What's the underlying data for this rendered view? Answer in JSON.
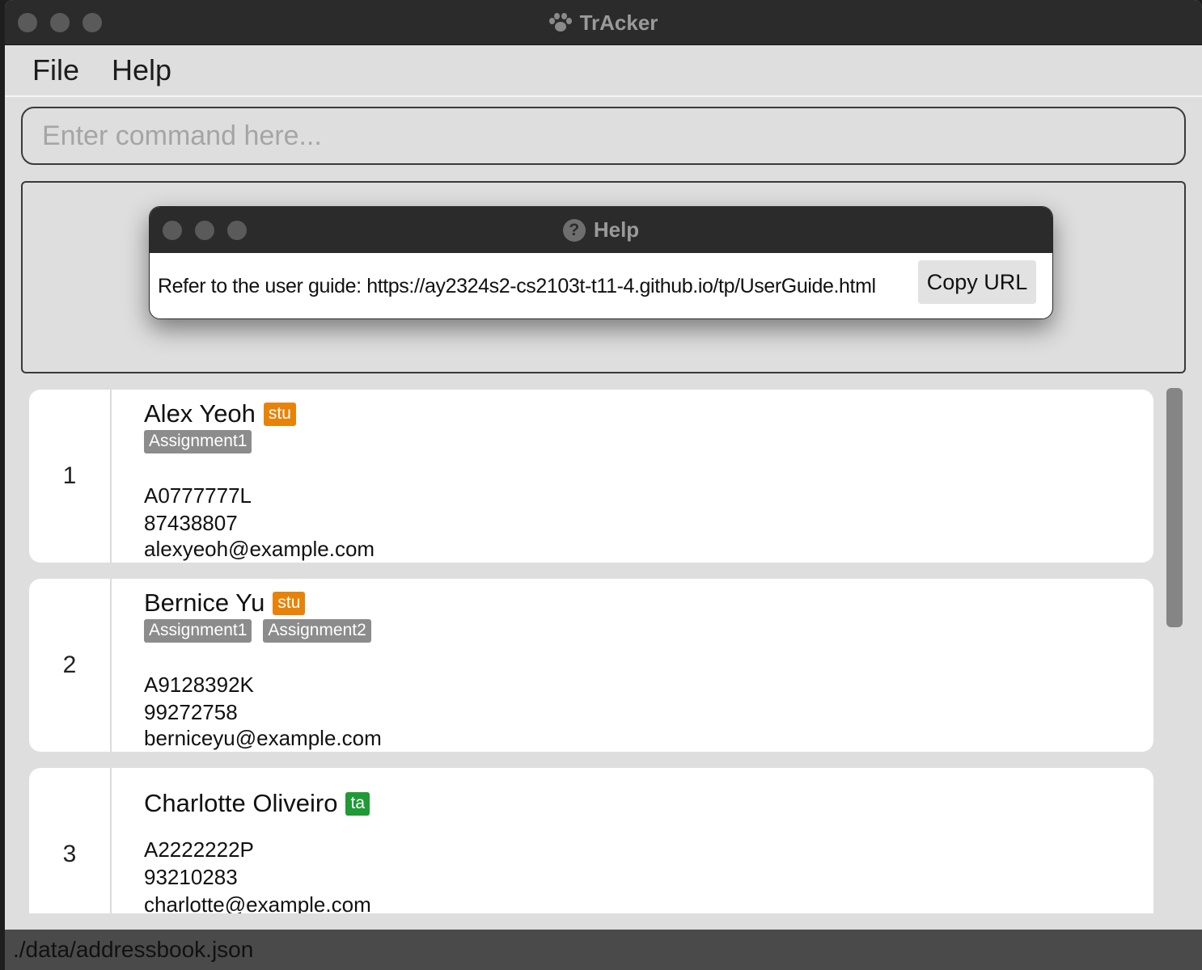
{
  "window": {
    "title": "TrAcker"
  },
  "menu": {
    "file": "File",
    "help": "Help"
  },
  "command": {
    "placeholder": "Enter command here...",
    "value": ""
  },
  "help_dialog": {
    "title": "Help",
    "message": "Refer to the user guide: https://ay2324s2-cs2103t-t11-4.github.io/tp/UserGuide.html",
    "copy_button": "Copy URL"
  },
  "persons": [
    {
      "index": "1",
      "name": "Alex Yeoh",
      "role": "stu",
      "tags": [
        "Assignment1"
      ],
      "id": "A0777777L",
      "phone": "87438807",
      "email": "alexyeoh@example.com"
    },
    {
      "index": "2",
      "name": "Bernice Yu",
      "role": "stu",
      "tags": [
        "Assignment1",
        "Assignment2"
      ],
      "id": "A9128392K",
      "phone": "99272758",
      "email": "berniceyu@example.com"
    },
    {
      "index": "3",
      "name": "Charlotte Oliveiro",
      "role": "ta",
      "tags": [],
      "id": "A2222222P",
      "phone": "93210283",
      "email": "charlotte@example.com"
    }
  ],
  "status": {
    "file_path": "./data/addressbook.json"
  },
  "colors": {
    "role_stu": "#e8830a",
    "role_ta": "#1f9a35",
    "tag": "#8c8c8c"
  }
}
